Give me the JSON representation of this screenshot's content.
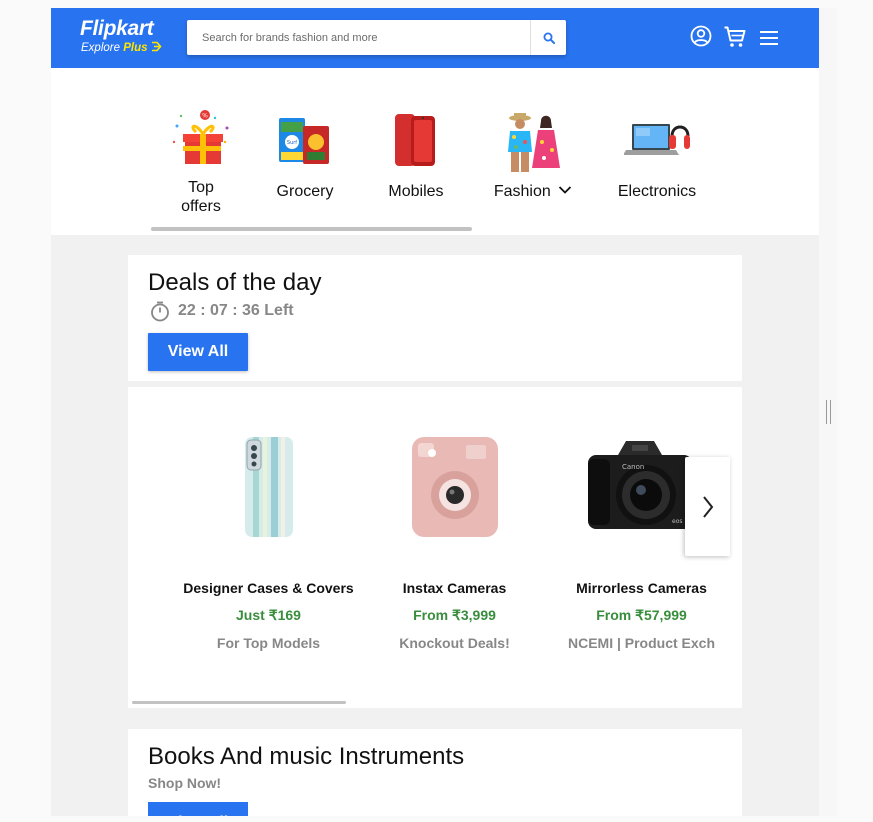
{
  "header": {
    "logo_text": "Flipkart",
    "logo_sub_text": "Explore",
    "logo_plus_text": "Plus",
    "search_placeholder": "Search for brands fashion and more",
    "icons": [
      "search-icon",
      "account-icon",
      "cart-icon",
      "hamburger-menu-icon"
    ],
    "brand_color": "#2874f0",
    "accent_color": "#ffe500"
  },
  "categories": [
    {
      "label": "Top offers",
      "icon": "gift-offers-icon"
    },
    {
      "label": "Grocery",
      "icon": "grocery-icon"
    },
    {
      "label": "Mobiles",
      "icon": "mobile-phone-icon"
    },
    {
      "label": "Fashion",
      "icon": "fashion-icon",
      "has_dropdown": true
    },
    {
      "label": "Electronics",
      "icon": "laptop-headphones-icon"
    }
  ],
  "deals": {
    "title": "Deals of the day",
    "timer": "22 : 07 : 36 Left",
    "view_all": "View All",
    "products": [
      {
        "name": "Designer Cases & Covers",
        "price": "Just ₹169",
        "note": "For Top Models",
        "image": "phone-case-image"
      },
      {
        "name": "Instax Cameras",
        "price": "From ₹3,999",
        "note": "Knockout Deals!",
        "image": "instax-camera-image"
      },
      {
        "name": "Mirrorless Cameras",
        "price": "From ₹57,999",
        "note": "NCEMI | Product Exch",
        "image": "mirrorless-camera-image"
      }
    ],
    "price_color": "#388e3c"
  },
  "books": {
    "title": "Books And music Instruments",
    "subtitle": "Shop Now!",
    "view_all": "View All"
  }
}
